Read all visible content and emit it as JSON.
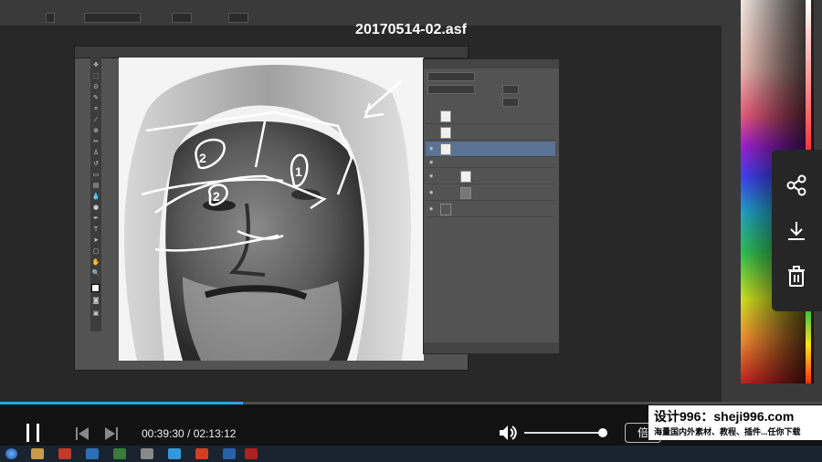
{
  "video": {
    "title": "20170514-02.asf",
    "current_time": "00:39:30",
    "total_time": "02:13:12",
    "time_display": "00:39:30 / 02:13:12",
    "progress": 0.296,
    "volume": 0.95,
    "speed_label": "倍"
  },
  "watermark": {
    "title": "设计996：sheji996.com",
    "subtitle": "海量国内外素材、教程、插件...任你下载"
  },
  "share_bar": {
    "items": [
      {
        "icon": "share-icon"
      },
      {
        "icon": "download-icon"
      },
      {
        "icon": "trash-icon"
      }
    ]
  },
  "colors": {
    "accent": "#2ea1e8",
    "layer_selected": "#5a7394",
    "panel_bg": "#535353"
  }
}
